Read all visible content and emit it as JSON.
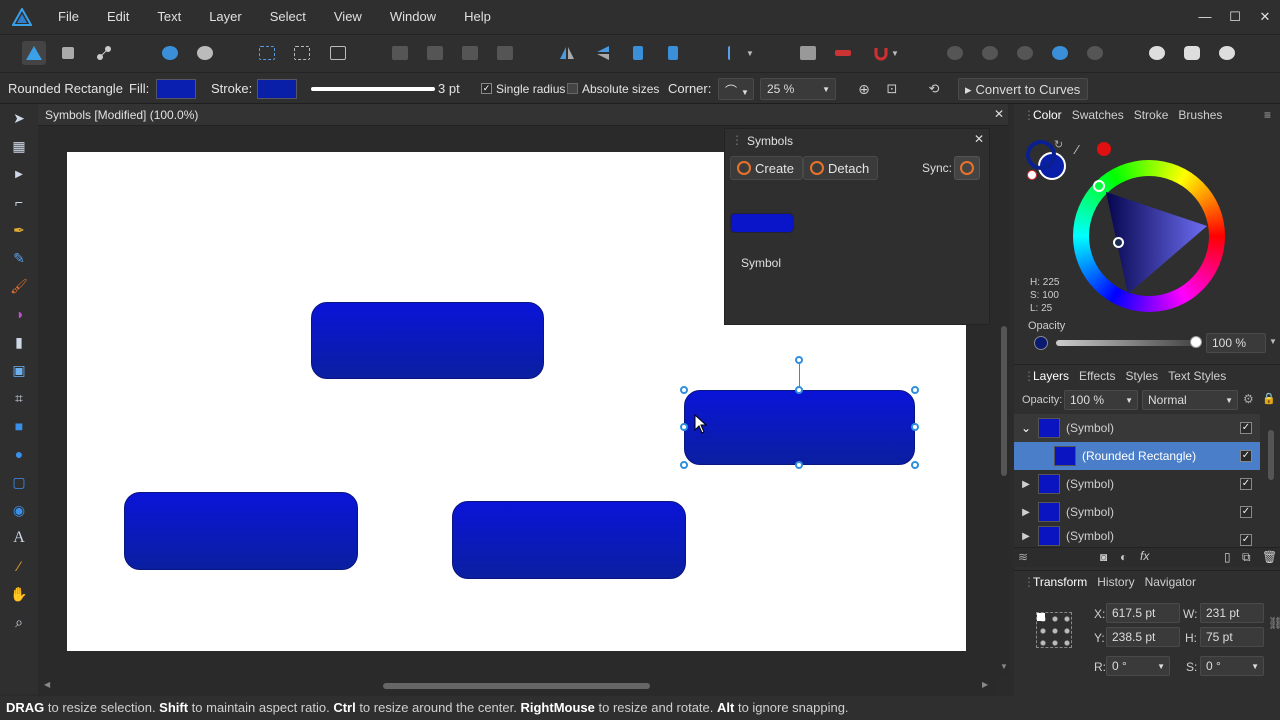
{
  "menu": [
    "File",
    "Edit",
    "Text",
    "Layer",
    "Select",
    "View",
    "Window",
    "Help"
  ],
  "window_controls": [
    "—",
    "☐",
    "✕"
  ],
  "context": {
    "object_type": "Rounded Rectangle",
    "fill_label": "Fill:",
    "stroke_label": "Stroke:",
    "stroke_width": "3 pt",
    "single_radius": "Single radius",
    "absolute_sizes": "Absolute sizes",
    "corner_label": "Corner:",
    "corner_value": "25 %",
    "convert_label": "Convert to Curves",
    "fill_color": "#0a1fb0",
    "stroke_color": "#0a1fa8"
  },
  "document": {
    "tab_title": "Symbols [Modified] (100.0%)"
  },
  "symbols_panel": {
    "title": "Symbols",
    "create": "Create",
    "detach": "Detach",
    "sync": "Sync:",
    "symbol_name": "Symbol"
  },
  "color_panel": {
    "tabs": [
      "Color",
      "Swatches",
      "Stroke",
      "Brushes"
    ],
    "h": "H: 225",
    "s": "S: 100",
    "l": "L: 25",
    "opacity_label": "Opacity",
    "opacity_value": "100 %",
    "opacity_level": 1.0
  },
  "layers_panel": {
    "tabs": [
      "Layers",
      "Effects",
      "Styles",
      "Text Styles"
    ],
    "opacity_label": "Opacity:",
    "opacity_value": "100 %",
    "blend": "Normal",
    "items": [
      {
        "name": "(Symbol)",
        "expanded": true
      },
      {
        "name": "(Rounded Rectangle)",
        "selected": true
      },
      {
        "name": "(Symbol)"
      },
      {
        "name": "(Symbol)"
      },
      {
        "name": "(Symbol)"
      }
    ]
  },
  "transform_panel": {
    "tabs": [
      "Transform",
      "History",
      "Navigator"
    ],
    "x_label": "X:",
    "x": "617.5 pt",
    "y_label": "Y:",
    "y": "238.5 pt",
    "w_label": "W:",
    "w": "231 pt",
    "h_label": "H:",
    "h": "75 pt",
    "r_label": "R:",
    "r": "0 °",
    "s_label": "S:",
    "s": "0 °"
  },
  "status": {
    "k1": "DRAG",
    "t1": " to resize selection. ",
    "k2": "Shift",
    "t2": " to maintain aspect ratio. ",
    "k3": "Ctrl",
    "t3": " to resize around the center. ",
    "k4": "RightMouse",
    "t4": " to resize and rotate. ",
    "k5": "Alt",
    "t5": " to ignore snapping."
  }
}
